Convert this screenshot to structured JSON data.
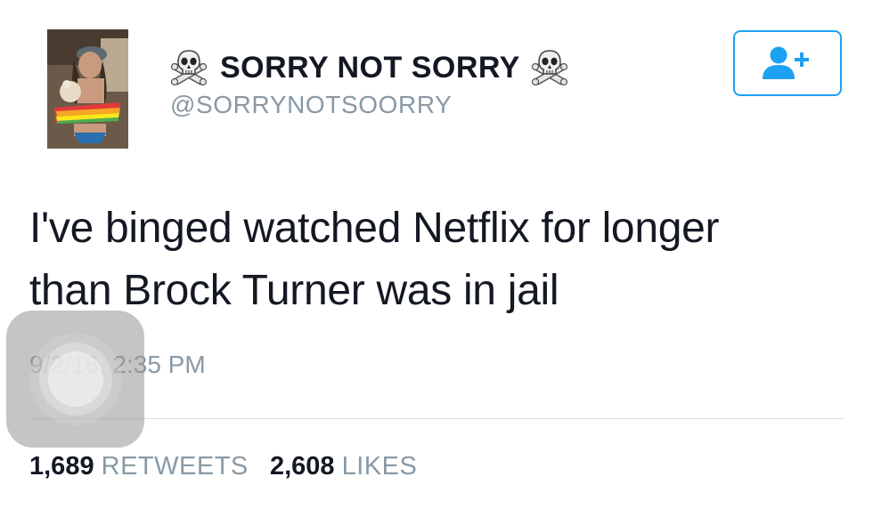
{
  "profile": {
    "display_name": "SORRY NOT SORRY",
    "handle": "@SORRYNOTSOORRY",
    "avatar_icon": "profile-photo",
    "name_decoration_icon": "skull-crossbones-icon"
  },
  "follow_button": {
    "icon": "add-user-icon",
    "color": "#1da1f2"
  },
  "tweet": {
    "text_line_1": "I've binged watched Netflix for longer",
    "text_line_2": "than Brock Turner was in jail",
    "timestamp": "9/2/16, 2:35 PM"
  },
  "stats": {
    "retweets_count": "1,689",
    "retweets_label": "RETWEETS",
    "likes_count": "2,608",
    "likes_label": "LIKES"
  },
  "overlay": {
    "icon": "assistive-touch-icon"
  }
}
